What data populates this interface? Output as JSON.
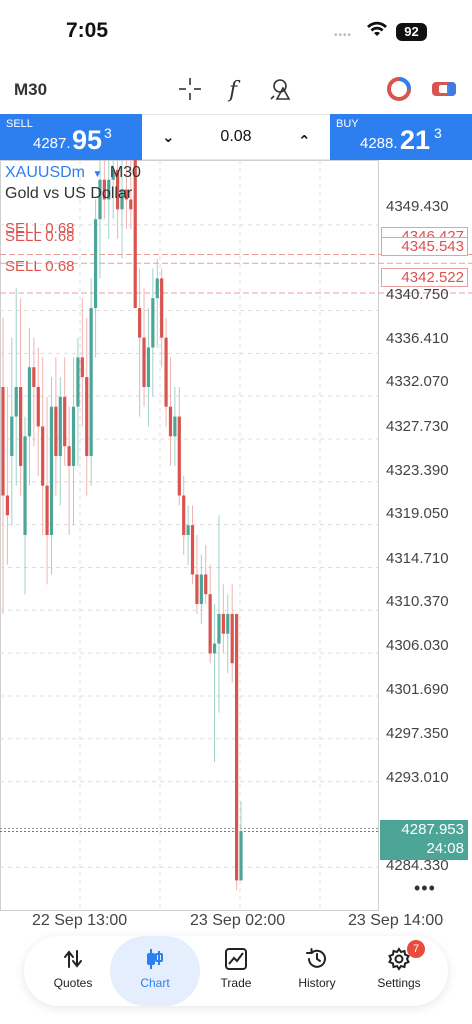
{
  "status_bar": {
    "time": "7:05",
    "battery": "92",
    "signal_dots": "••••"
  },
  "toolbar": {
    "timeframe": "M30",
    "icons": [
      "crosshair-icon",
      "function-icon",
      "objects-icon",
      "trade-toggle-icon",
      "one-click-icon"
    ]
  },
  "trade_bar": {
    "sell": {
      "label": "SELL",
      "price_prefix": "4287.",
      "price_big": "95",
      "price_sup": "3"
    },
    "buy": {
      "label": "BUY",
      "price_prefix": "4288.",
      "price_big": "21",
      "price_sup": "3"
    },
    "volume": "0.08",
    "decrease_label": "⌄",
    "increase_label": "⌃"
  },
  "chart": {
    "symbol": "XAUUSDm",
    "caret": "▼",
    "timeframe": "M30",
    "description": "Gold vs US Dollar",
    "sell_orders": [
      {
        "label": "SELL 0.68",
        "price": "4346.427"
      },
      {
        "label": "SELL 0.68",
        "price": "4345.543"
      },
      {
        "label": "SELL 0.68",
        "price": "4342.522"
      }
    ],
    "y_ticks": [
      "4349.430",
      "4340.750",
      "4336.410",
      "4332.070",
      "4327.730",
      "4323.390",
      "4319.050",
      "4314.710",
      "4310.370",
      "4306.030",
      "4301.690",
      "4297.350",
      "4293.010",
      "4284.330"
    ],
    "current_price": "4287.953",
    "timer": "24:08",
    "x_ticks": [
      "22 Sep 13:00",
      "23 Sep 02:00",
      "23 Sep 14:00"
    ],
    "more_label": "•••",
    "colors": {
      "bull": "#4da597",
      "bear": "#d9534f",
      "grid": "#dddddd",
      "accent": "#2d7ff0"
    }
  },
  "chart_data": {
    "type": "candlestick",
    "symbol": "XAUUSDm",
    "timeframe": "M30",
    "y_range": [
      4280.0,
      4356.0
    ],
    "candles": [
      {
        "o": 4333,
        "h": 4340,
        "l": 4310,
        "c": 4322
      },
      {
        "o": 4322,
        "h": 4333,
        "l": 4315,
        "c": 4320
      },
      {
        "o": 4326,
        "h": 4338,
        "l": 4319,
        "c": 4330
      },
      {
        "o": 4330,
        "h": 4343,
        "l": 4323,
        "c": 4333
      },
      {
        "o": 4333,
        "h": 4342,
        "l": 4322,
        "c": 4325
      },
      {
        "o": 4318,
        "h": 4330,
        "l": 4312,
        "c": 4328
      },
      {
        "o": 4328,
        "h": 4339,
        "l": 4323,
        "c": 4335
      },
      {
        "o": 4335,
        "h": 4338,
        "l": 4327,
        "c": 4333
      },
      {
        "o": 4333,
        "h": 4337,
        "l": 4324,
        "c": 4329
      },
      {
        "o": 4329,
        "h": 4336,
        "l": 4318,
        "c": 4323
      },
      {
        "o": 4323,
        "h": 4332,
        "l": 4313,
        "c": 4318
      },
      {
        "o": 4318,
        "h": 4334,
        "l": 4314,
        "c": 4331
      },
      {
        "o": 4331,
        "h": 4336,
        "l": 4322,
        "c": 4326
      },
      {
        "o": 4326,
        "h": 4334,
        "l": 4321,
        "c": 4332
      },
      {
        "o": 4332,
        "h": 4336,
        "l": 4325,
        "c": 4327
      },
      {
        "o": 4327,
        "h": 4331,
        "l": 4318,
        "c": 4325
      },
      {
        "o": 4325,
        "h": 4336,
        "l": 4319,
        "c": 4331
      },
      {
        "o": 4331,
        "h": 4338,
        "l": 4325,
        "c": 4336
      },
      {
        "o": 4336,
        "h": 4342,
        "l": 4329,
        "c": 4334
      },
      {
        "o": 4334,
        "h": 4340,
        "l": 4322,
        "c": 4326
      },
      {
        "o": 4326,
        "h": 4344,
        "l": 4323,
        "c": 4341
      },
      {
        "o": 4341,
        "h": 4352,
        "l": 4336,
        "c": 4350
      },
      {
        "o": 4350,
        "h": 4356,
        "l": 4344,
        "c": 4354
      },
      {
        "o": 4354,
        "h": 4356,
        "l": 4350,
        "c": 4352
      },
      {
        "o": 4352,
        "h": 4356,
        "l": 4348,
        "c": 4354
      },
      {
        "o": 4354,
        "h": 4356,
        "l": 4350,
        "c": 4355
      },
      {
        "o": 4355,
        "h": 4356,
        "l": 4348,
        "c": 4351
      },
      {
        "o": 4351,
        "h": 4356,
        "l": 4346,
        "c": 4353
      },
      {
        "o": 4353,
        "h": 4356,
        "l": 4349,
        "c": 4352
      },
      {
        "o": 4352,
        "h": 4356,
        "l": 4349,
        "c": 4351
      },
      {
        "o": 4356,
        "h": 4356,
        "l": 4346,
        "c": 4341
      },
      {
        "o": 4341,
        "h": 4345,
        "l": 4330,
        "c": 4338
      },
      {
        "o": 4338,
        "h": 4343,
        "l": 4331,
        "c": 4333
      },
      {
        "o": 4333,
        "h": 4341,
        "l": 4329,
        "c": 4337
      },
      {
        "o": 4337,
        "h": 4345,
        "l": 4332,
        "c": 4342
      },
      {
        "o": 4342,
        "h": 4346,
        "l": 4337,
        "c": 4344
      },
      {
        "o": 4344,
        "h": 4345,
        "l": 4335,
        "c": 4338
      },
      {
        "o": 4338,
        "h": 4340,
        "l": 4329,
        "c": 4331
      },
      {
        "o": 4331,
        "h": 4336,
        "l": 4325,
        "c": 4328
      },
      {
        "o": 4328,
        "h": 4333,
        "l": 4325,
        "c": 4330
      },
      {
        "o": 4330,
        "h": 4333,
        "l": 4321,
        "c": 4322
      },
      {
        "o": 4322,
        "h": 4324,
        "l": 4316,
        "c": 4318
      },
      {
        "o": 4318,
        "h": 4321,
        "l": 4315,
        "c": 4319
      },
      {
        "o": 4319,
        "h": 4321,
        "l": 4313,
        "c": 4314
      },
      {
        "o": 4314,
        "h": 4318,
        "l": 4310,
        "c": 4311
      },
      {
        "o": 4311,
        "h": 4316,
        "l": 4309,
        "c": 4314
      },
      {
        "o": 4314,
        "h": 4317,
        "l": 4311,
        "c": 4312
      },
      {
        "o": 4312,
        "h": 4315,
        "l": 4305,
        "c": 4306
      },
      {
        "o": 4306,
        "h": 4311,
        "l": 4295,
        "c": 4307
      },
      {
        "o": 4307,
        "h": 4320,
        "l": 4300,
        "c": 4310
      },
      {
        "o": 4310,
        "h": 4313,
        "l": 4306,
        "c": 4308
      },
      {
        "o": 4308,
        "h": 4312,
        "l": 4304,
        "c": 4310
      },
      {
        "o": 4310,
        "h": 4313,
        "l": 4303,
        "c": 4305
      },
      {
        "o": 4310,
        "h": 4310,
        "l": 4282,
        "c": 4283
      },
      {
        "o": 4283,
        "h": 4291,
        "l": 4283,
        "c": 4288
      }
    ]
  },
  "nav": {
    "items": [
      {
        "label": "Quotes",
        "icon": "quotes-arrows-icon"
      },
      {
        "label": "Chart",
        "icon": "candlestick-chart-icon"
      },
      {
        "label": "Trade",
        "icon": "trade-graph-icon"
      },
      {
        "label": "History",
        "icon": "history-clock-icon"
      },
      {
        "label": "Settings",
        "icon": "settings-gear-icon"
      }
    ],
    "settings_badge": "7"
  }
}
